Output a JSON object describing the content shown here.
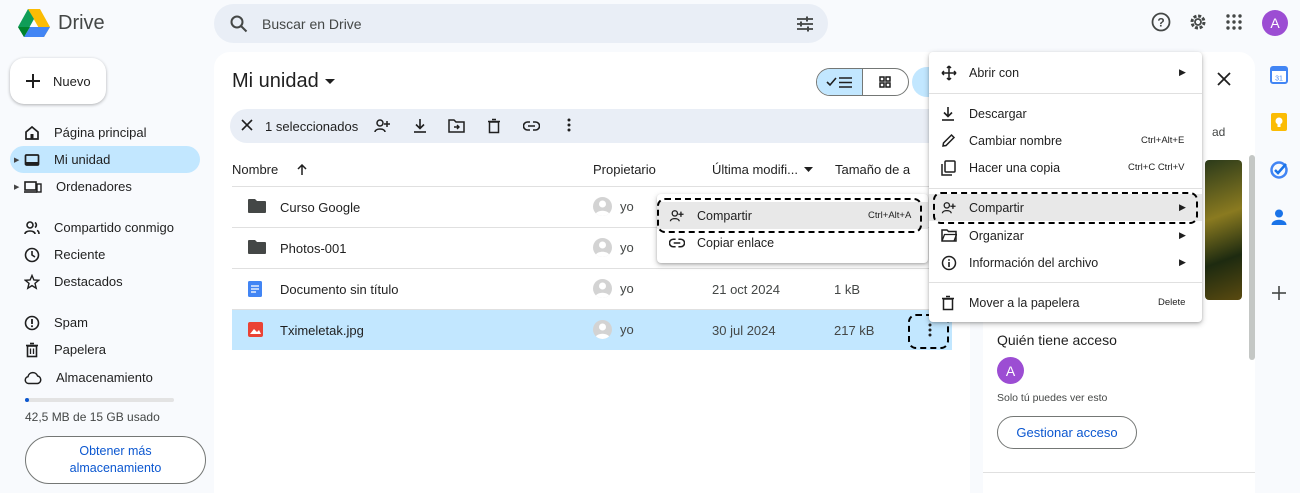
{
  "header": {
    "app_name": "Drive",
    "search_placeholder": "Buscar en Drive",
    "avatar_letter": "A"
  },
  "sidebar": {
    "new_label": "Nuevo",
    "items": [
      {
        "label": "Página principal",
        "icon": "home-icon"
      },
      {
        "label": "Mi unidad",
        "icon": "my-drive-icon",
        "active": true
      },
      {
        "label": "Ordenadores",
        "icon": "computers-icon"
      },
      {
        "label": "Compartido conmigo",
        "icon": "shared-icon"
      },
      {
        "label": "Reciente",
        "icon": "clock-icon"
      },
      {
        "label": "Destacados",
        "icon": "star-icon"
      },
      {
        "label": "Spam",
        "icon": "spam-icon"
      },
      {
        "label": "Papelera",
        "icon": "trash-icon"
      },
      {
        "label": "Almacenamiento",
        "icon": "cloud-icon"
      }
    ],
    "quota_text": "42,5 MB de 15 GB usado",
    "quota_fraction": 0.003,
    "get_more_line1": "Obtener más",
    "get_more_line2": "almacenamiento"
  },
  "main": {
    "title": "Mi unidad",
    "selection_count": "1 seleccionados",
    "columns": {
      "name": "Nombre",
      "owner": "Propietario",
      "modified": "Última modifi...",
      "size": "Tamaño de a"
    },
    "files": [
      {
        "name": "Curso Google",
        "owner": "yo",
        "date": "",
        "size": "",
        "type": "folder"
      },
      {
        "name": "Photos-001",
        "owner": "yo",
        "date": "",
        "size": "",
        "type": "folder"
      },
      {
        "name": "Documento sin título",
        "owner": "yo",
        "date": "21 oct 2024",
        "size": "1 kB",
        "type": "doc"
      },
      {
        "name": "Tximeletak.jpg",
        "owner": "yo",
        "date": "30 jul 2024",
        "size": "217 kB",
        "type": "image",
        "selected": true
      }
    ]
  },
  "details_panel": {
    "header_fragment": "ad",
    "who_has_access": "Quién tiene acceso",
    "avatar_letter": "A",
    "only_you": "Solo tú puedes ver esto",
    "manage_access": "Gestionar acceso"
  },
  "context_menu": {
    "open_with": "Abrir con",
    "download": "Descargar",
    "rename": "Cambiar nombre",
    "rename_shortcut": "Ctrl+Alt+E",
    "copy": "Hacer una copia",
    "copy_shortcut": "Ctrl+C Ctrl+V",
    "share": "Compartir",
    "organize": "Organizar",
    "file_info": "Información del archivo",
    "trash": "Mover a la papelera",
    "trash_shortcut": "Delete"
  },
  "share_submenu": {
    "share": "Compartir",
    "share_shortcut": "Ctrl+Alt+A",
    "copy_link": "Copiar enlace"
  },
  "colors": {
    "accent": "#0b57d0",
    "selected": "#c2e7ff",
    "avatar": "#9c4dd3"
  }
}
